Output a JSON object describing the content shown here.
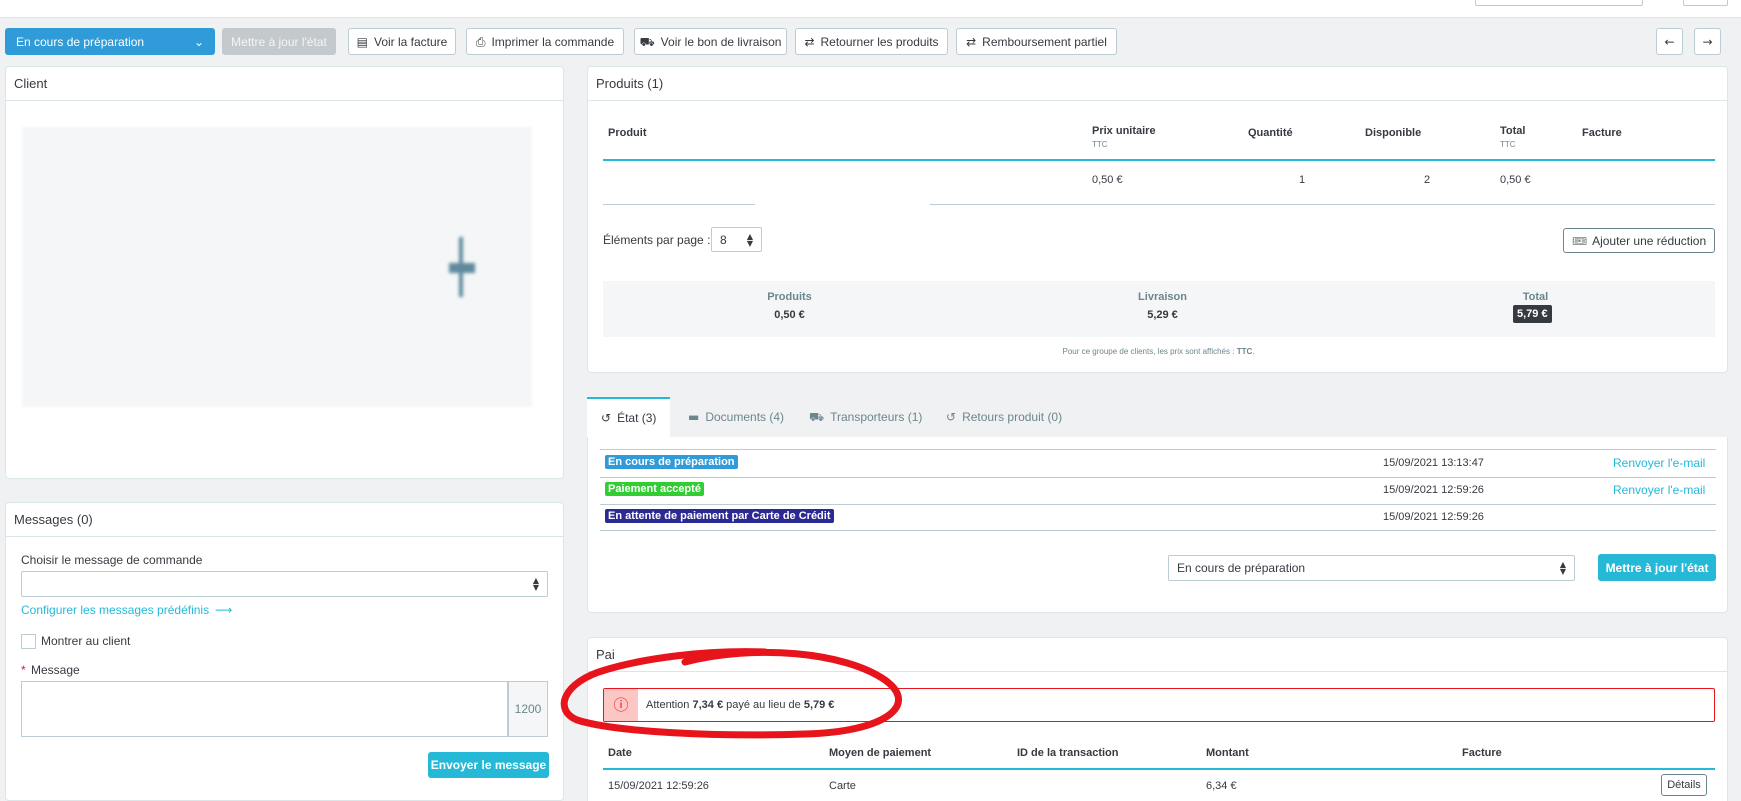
{
  "toolbar": {
    "status_select": "En cours de préparation",
    "update_state": "Mettre à jour l'état",
    "view_invoice": "Voir la facture",
    "print_order": "Imprimer la commande",
    "view_delivery": "Voir le bon de livraison",
    "return_products": "Retourner les produits",
    "partial_refund": "Remboursement partiel"
  },
  "client": {
    "title": "Client"
  },
  "messages": {
    "title": "Messages (0)",
    "choose_label": "Choisir le message de commande",
    "choose_value": "",
    "configure_link": "Configurer les messages prédéfinis",
    "show_client": "Montrer au client",
    "required_mark": "*",
    "message_label": "Message",
    "char_count": "1200",
    "send_button": "Envoyer le message"
  },
  "products": {
    "title": "Produits (1)",
    "headers": {
      "product": "Produit",
      "unit_price": "Prix unitaire",
      "unit_price_sub": "TTC",
      "quantity": "Quantité",
      "available": "Disponible",
      "total": "Total",
      "total_sub": "TTC",
      "invoice": "Facture"
    },
    "row": {
      "unit_price": "0,50 €",
      "quantity": "1",
      "available": "2",
      "total": "0,50 €"
    },
    "per_page_label": "Éléments par page :",
    "per_page_value": "8",
    "add_discount": "Ajouter une réduction",
    "summary": {
      "products_label": "Produits",
      "products_value": "0,50 €",
      "shipping_label": "Livraison",
      "shipping_value": "5,29 €",
      "total_label": "Total",
      "total_value": "5,79 €"
    },
    "note_prefix": "Pour ce groupe de clients, les prix sont affichés :",
    "note_bold": "TTC",
    "note_suffix": "."
  },
  "tabs": {
    "state": "État (3)",
    "documents": "Documents (4)",
    "carriers": "Transporteurs (1)",
    "returns": "Retours produit (0)"
  },
  "history": [
    {
      "status": "En cours de préparation",
      "color": "#2f9bd8",
      "date": "15/09/2021 13:13:47",
      "action": "Renvoyer l'e-mail"
    },
    {
      "status": "Paiement accepté",
      "color": "#32cd32",
      "date": "15/09/2021 12:59:26",
      "action": "Renvoyer l'e-mail"
    },
    {
      "status": "En attente de paiement par Carte de Crédit",
      "color": "#4169e1",
      "date": "15/09/2021 12:59:26",
      "action": ""
    }
  ],
  "state_form": {
    "select_value": "En cours de préparation",
    "submit": "Mettre à jour l'état"
  },
  "payment": {
    "title": "Pai",
    "alert_prefix": "Attention",
    "alert_paid": "7,34 €",
    "alert_middle": "payé au lieu de",
    "alert_expected": "5,79 €",
    "headers": {
      "date": "Date",
      "method": "Moyen de paiement",
      "txn": "ID de la transaction",
      "amount": "Montant",
      "invoice": "Facture"
    },
    "row": {
      "date": "15/09/2021 12:59:26",
      "method": "Carte",
      "amount": "6,34 €",
      "details": "Détails"
    }
  },
  "colors": {
    "teal": "#25b9d7",
    "blue": "#2f9bd8",
    "annotation_red": "#e8141c"
  },
  "icons": [
    "chevron-down-icon",
    "file-icon",
    "print-icon",
    "truck-icon",
    "swap-icon",
    "arrow-left-icon",
    "arrow-right-icon",
    "history-icon",
    "folder-icon",
    "undo-icon",
    "ticket-icon",
    "alert-icon",
    "arrow-right-long-icon"
  ]
}
